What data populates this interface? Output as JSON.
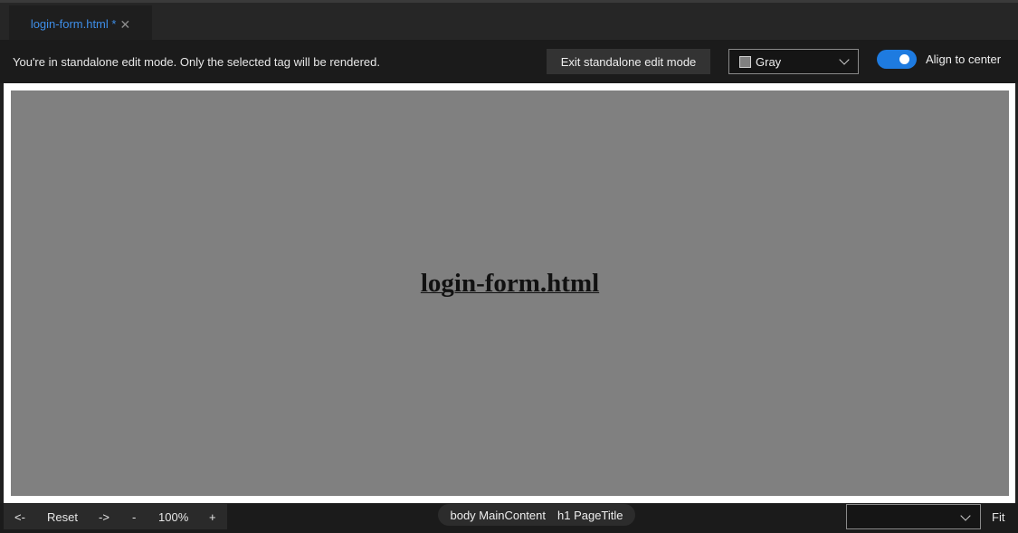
{
  "tab": {
    "title": "login-form.html *",
    "close_glyph": "✕",
    "accent_color": "#3e8ee8"
  },
  "mode_bar": {
    "message": "You're in standalone edit mode. Only the selected tag will be rendered.",
    "exit_label": "Exit standalone edit mode",
    "background_select": {
      "value": "Gray",
      "swatch_color": "#808080"
    },
    "align_toggle": {
      "label": "Align to center",
      "on": true,
      "color": "#1e7be0"
    }
  },
  "preview": {
    "heading": "login-form.html",
    "canvas_color": "#808080"
  },
  "bottom_bar": {
    "back_label": "<-",
    "reset_label": "Reset",
    "forward_label": "->",
    "zoom_out_label": "-",
    "zoom_level": "100%",
    "zoom_in_label": "+",
    "breadcrumbs": [
      "body MainContent",
      "h1 PageTitle"
    ],
    "size_select_value": "",
    "fit_label": "Fit"
  }
}
